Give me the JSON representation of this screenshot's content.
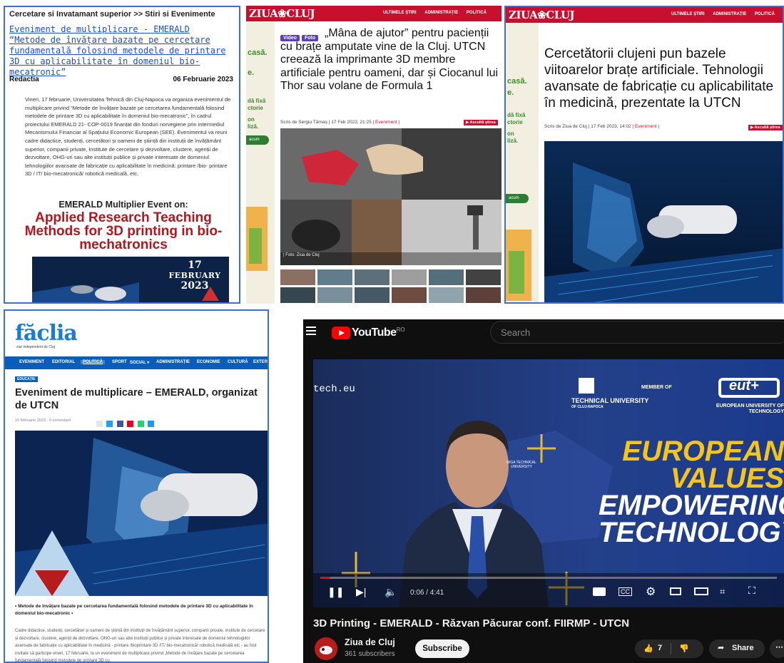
{
  "panel1": {
    "breadcrumb": "Cercetare si Invatamant superior >> Stiri si Evenimente",
    "headline": "Eveniment de multiplicare - EMERALD “Metode de învățare bazate pe cercetare fundamentală folosind metodele de printare 3D cu aplicabilitate în domeniul bio-mecatronic”",
    "author": "Redactia",
    "date": "06 Februarie 2023",
    "body": "Vineri, 17 februarie, Universitatea Tehnică din Cluj-Napoca va organiza evenimentul de multiplicare privind “Metode de învățare bazate pe cercetarea fundamentală folosind metodele de printare 3D cu aplicabilitate în domeniul bio-mecatronic”, în cadrul proiectului EMERALD 21- COP-0019 finanțat din fonduri norvegiene prin intermediul Mecanismului Financiar al Spațiului Economic European (SEE). Evenimentul va reuni cadre didactice, studenți, cercetători și oameni de știință din instituții de învățământ superior, companii private, institute de cercetare și dezvoltare, clustere, agenții de dezvoltare, OHG-uri sau alte instituții publice și private interesate de domeniul tehnologiilor avansate de fabricație cu aplicabilitate în medicină: printare /bio- printare 3D / IT/ bio-mecatronică/ robotică medicală, etc.",
    "event_subtitle": "EMERALD Multiplier Event on:",
    "event_title": "Applied Research Teaching Methods for 3D printing in bio-mechatronics",
    "banner_day": "17",
    "banner_month": "FEBRUARY",
    "banner_year": "2023"
  },
  "ziua_nav": [
    "ULTIMELE ȘTIRI",
    "ADMINISTRAȚIE",
    "POLITICĂ"
  ],
  "ziua_logo": "ZIUA❀CLUJ",
  "panel2": {
    "tag_video": "Video",
    "tag_foto": "Foto",
    "title": "„Mâna de ajutor” pentru pacienții cu brațe amputate vine de la Cluj. UTCN creează la imprimante 3D membre artificiale pentru oameni, dar și Ciocanul lui Thor sau volane de Formula 1",
    "meta_by": "Scris de Sergiu Tărnaș",
    "meta_date": "17 Feb 2023, 21:25",
    "meta_cat": "Eveniment",
    "listen": "▶ Ascultă știrea",
    "caption": "| Foto: Ziua de Cluj",
    "ad_words": [
      "casă.",
      "e.",
      "dă fixă",
      "ctorie",
      "on",
      "liză."
    ],
    "ad_pill": "acum"
  },
  "panel3": {
    "title": "Cercetătorii clujeni pun bazele viitoarelor brațe artificiale. Tehnologii avansate de fabricație cu aplicabilitate în medicină, prezentate la UTCN",
    "meta_by": "Scris de Ziua de Cluj",
    "meta_date": "17 Feb 2023, 14:02",
    "meta_cat": "Eveniment",
    "listen": "▶ Ascultă știrea",
    "ad_words": [
      "casă.",
      "e.",
      "dă fixă",
      "ctorie",
      "on",
      "liză."
    ],
    "ad_pill": "acum"
  },
  "panel4": {
    "logo": "făclia",
    "logo_sub": "ziar independent de Cluj",
    "nav": [
      "EVENIMENT",
      "EDITORIAL",
      "POLITICĂ",
      "SPORT",
      "SOCIAL ▾",
      "ADMINISTRAȚIE",
      "ECONOMIE",
      "CULTURĂ",
      "EXTER"
    ],
    "category": "EDUCAȚIE",
    "title": "Eveniment de multiplicare – EMERALD, organizat de UTCN",
    "meta": "15 februarie 2023 · 0 comentarii",
    "lead": "• Metode de învățare bazate pe cercetarea fundamentală folosind metodele de printare 3D cu aplicabilitate în domeniul bio-mecatronic •",
    "body": "Cadre didactice, studenți, cercetători și oameni de știință din instituții de învățământ superior, companii private, institute de cercetare și dezvoltare, clustere, agenții de dezvoltare, ONG-uri sau alte instituții publice și private interesate de domeniul tehnologiilor avansate de fabricație cu aplicabilitate în medicină - printare /bioprintare 3D /IT/ bio-mecatronică/ robotică medicală etc - au fost invitate să participe vineri, 17 februarie, la un eveniment de multiplicare privind „Metode de învățare bazate pe cercetarea fundamentală folosind metodele de printare 3D cu"
  },
  "panel5": {
    "yt_word": "YouTube",
    "yt_region": "RO",
    "search_placeholder": "Search",
    "video_overlay": {
      "url_fragment": "tech.eu",
      "member_of": "MEMBER OF",
      "eut_short": "eut+",
      "eut_full": "EUROPEAN UNIVERSITY OF TECHNOLOGY",
      "tu_name": "TECHNICAL UNIVERSITY",
      "tu_sub": "OF CLUJ-NAPOCA",
      "riga": "RIGA TECHNICAL UNIVERSITY",
      "slogan": [
        "EUROPEAN",
        "VALUES",
        "EMPOWERING",
        "TECHNOLOGY"
      ],
      "time": "0:06 / 4:41"
    },
    "progress": 0.021,
    "title": "3D Printing - EMERALD - Răzvan Păcurar conf. FIIRMP - UTCN",
    "channel": "Ziua de Cluj",
    "subscribers": "361 subscribers",
    "subscribe_label": "Subscribe",
    "likes": "7",
    "share_label": "Share"
  }
}
